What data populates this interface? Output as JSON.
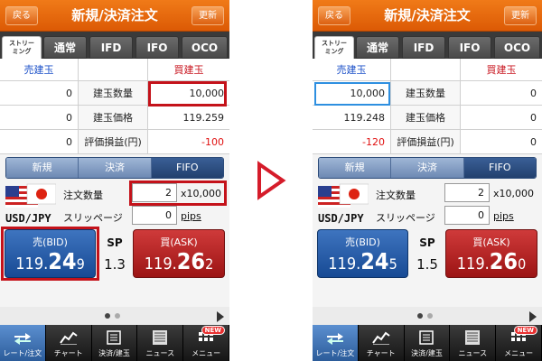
{
  "common": {
    "header": {
      "back": "戻る",
      "title": "新規/決済注文",
      "refresh": "更新"
    },
    "tabs": [
      "ストリー\nミング",
      "通常",
      "IFD",
      "IFO",
      "OCO"
    ],
    "grid": {
      "sell_header": "売建玉",
      "buy_header": "買建玉",
      "labels": [
        "建玉数量",
        "建玉価格",
        "評価損益(円)"
      ]
    },
    "segments": [
      "新規",
      "決済",
      "FIFO"
    ],
    "order": {
      "pair": "USD/JPY",
      "qty_label": "注文数量",
      "slip_label": "スリッページ",
      "qty_unit": "x10,000",
      "slip_unit": "pips",
      "sp_label": "SP"
    },
    "nav": [
      "レート/注文",
      "チャート",
      "決済/建玉",
      "ニュース",
      "メニュー"
    ],
    "new_badge": "NEW",
    "colors": {
      "header": "#e86a10",
      "bid": "#1f55a3",
      "ask": "#b21e1e",
      "highlight_red": "#c4121a",
      "highlight_blue": "#2e8fe0"
    }
  },
  "left": {
    "sell_values": [
      "0",
      "0",
      "0"
    ],
    "buy_values": [
      "10,000",
      "119.259",
      "-100"
    ],
    "qty": "2",
    "slippage": "0",
    "bid": {
      "label": "売(BID)",
      "p1": "119.",
      "p2": "24",
      "p3": "9"
    },
    "ask": {
      "label": "買(ASK)",
      "p1": "119.",
      "p2": "26",
      "p3": "2"
    },
    "spread": "1.3"
  },
  "right": {
    "sell_values": [
      "10,000",
      "119.248",
      "-120"
    ],
    "buy_values": [
      "0",
      "0",
      "0"
    ],
    "qty": "2",
    "slippage": "0",
    "bid": {
      "label": "売(BID)",
      "p1": "119.",
      "p2": "24",
      "p3": "5"
    },
    "ask": {
      "label": "買(ASK)",
      "p1": "119.",
      "p2": "26",
      "p3": "0"
    },
    "spread": "1.5"
  }
}
